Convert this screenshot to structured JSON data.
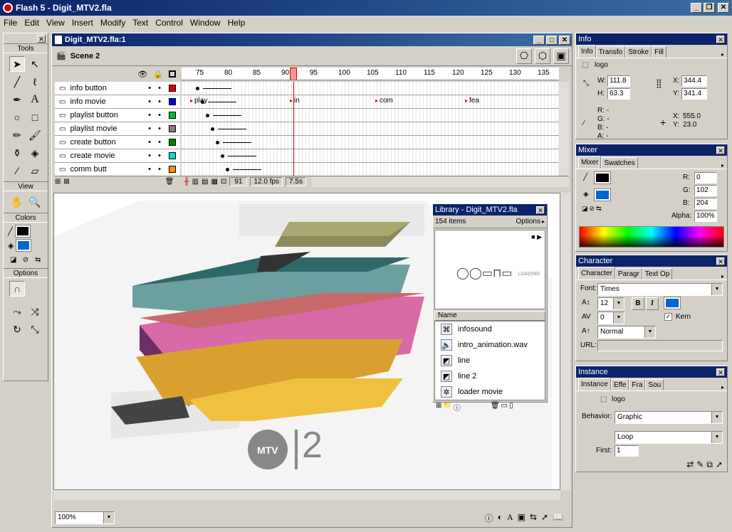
{
  "app": {
    "title": "Flash 5 - Digit_MTV2.fla"
  },
  "menu": [
    "File",
    "Edit",
    "View",
    "Insert",
    "Modify",
    "Text",
    "Control",
    "Window",
    "Help"
  ],
  "tools": {
    "title": "Tools",
    "view": "View",
    "colors": "Colors",
    "options": "Options"
  },
  "doc": {
    "title": "Digit_MTV2.fla:1",
    "scene": "Scene 2"
  },
  "timeline": {
    "frame_numbers": [
      "75",
      "80",
      "85",
      "90",
      "95",
      "100",
      "105",
      "110",
      "115",
      "120",
      "125",
      "130",
      "135"
    ],
    "layers": [
      {
        "name": "info button",
        "color": "#e00000"
      },
      {
        "name": "info movie",
        "color": "#0000e0"
      },
      {
        "name": "playlist button",
        "color": "#00c040"
      },
      {
        "name": "playlist movie",
        "color": "#808080"
      },
      {
        "name": "create button",
        "color": "#008000"
      },
      {
        "name": "create movie",
        "color": "#00e0e0"
      },
      {
        "name": "comm butt",
        "color": "#ff9000"
      }
    ],
    "labels": [
      "play",
      "in",
      "com",
      "fea"
    ],
    "current_frame": "91",
    "fps": "12.0 fps",
    "elapsed": "7.5s"
  },
  "library": {
    "title": "Library - Digit_MTV2.fla",
    "count": "154 items",
    "options": "Options",
    "column": "Name",
    "preview_text": "LOADING",
    "items": [
      {
        "name": "infosound",
        "icon": "button-icon"
      },
      {
        "name": "intro_animation.wav",
        "icon": "sound-icon"
      },
      {
        "name": "line",
        "icon": "graphic-icon"
      },
      {
        "name": "line 2",
        "icon": "graphic-icon"
      },
      {
        "name": "loader movie",
        "icon": "movie-clip-icon"
      }
    ]
  },
  "stage": {
    "zoom": "100%",
    "logo_text": "2"
  },
  "info": {
    "title": "Info",
    "tabs": [
      "Info",
      "Transfo",
      "Stroke",
      "Fill"
    ],
    "symbol": "logo",
    "w_label": "W:",
    "w": "111.8",
    "h_label": "H:",
    "h": "63.3",
    "x_label": "X:",
    "x": "344.4",
    "y_label": "Y:",
    "y": "341.4",
    "r_label": "R: -",
    "g_label": "G: -",
    "b_label": "B: -",
    "a_label": "A: -",
    "cx_label": "X:",
    "cx": "555.0",
    "cy_label": "Y:",
    "cy": "23.0"
  },
  "mixer": {
    "title": "Mixer",
    "tabs": [
      "Mixer",
      "Swatches"
    ],
    "r_label": "R:",
    "r": "0",
    "g_label": "G:",
    "g": "102",
    "b_label": "B:",
    "b": "204",
    "alpha_label": "Alpha:",
    "alpha": "100%",
    "fill_color": "#0066cc",
    "stroke_color": "#000000"
  },
  "character": {
    "title": "Character",
    "tabs": [
      "Character",
      "Paragr",
      "Text Op"
    ],
    "font_label": "Font:",
    "font": "Times",
    "size": "12",
    "bold": "B",
    "italic": "I",
    "tracking": "0",
    "kern_label": "Kern",
    "baseline": "Normal",
    "url_label": "URL:"
  },
  "instance": {
    "title": "Instance",
    "tabs": [
      "Instance",
      "Effe",
      "Fra",
      "Sou"
    ],
    "name": "logo",
    "behavior_label": "Behavior:",
    "behavior": "Graphic",
    "loop": "Loop",
    "first_label": "First:",
    "first": "1"
  }
}
